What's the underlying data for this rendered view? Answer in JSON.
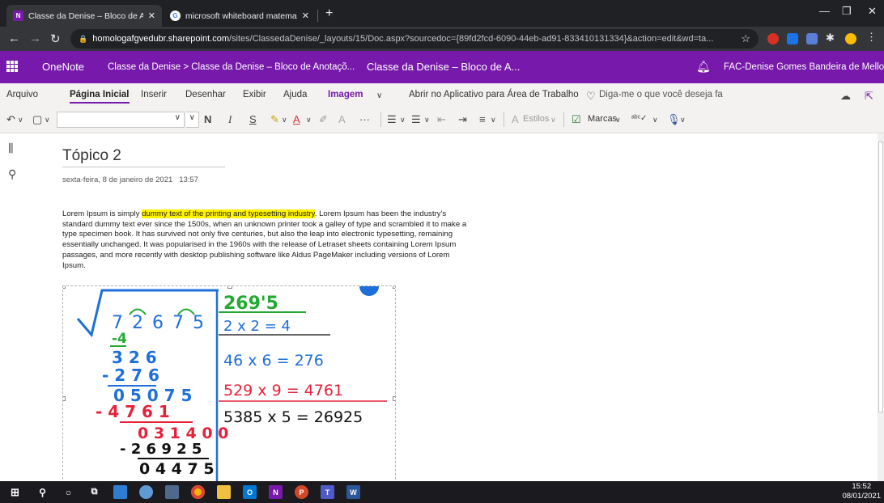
{
  "browser": {
    "tabs": [
      {
        "title": "Classe da Denise – Bloco de Anot",
        "favicon": "N"
      },
      {
        "title": "microsoft whiteboard matematic",
        "favicon": "G"
      }
    ],
    "url_host": "homologafgvedubr.sharepoint.com",
    "url_path": "/sites/ClassedaDenise/_layouts/15/Doc.aspx?sourcedoc={89fd2fcd-6090-44eb-ad91-833410131334}&action=edit&wd=ta..."
  },
  "onenote": {
    "app": "OneNote",
    "breadcrumb": "Classe da Denise  >  Classe da Denise – Bloco de Anotaçõ...",
    "notebook_title": "Classe da Denise – Bloco de A...",
    "user": "FAC-Denise Gomes Bandeira de Mello",
    "accent": "#7719aa"
  },
  "ribbon": {
    "tabs": [
      "Arquivo",
      "Página Inicial",
      "Inserir",
      "Desenhar",
      "Exibir",
      "Ajuda",
      "Imagem"
    ],
    "open_app": "Abrir no Aplicativo para Área de Trabalho",
    "tell_me": "Diga-me o que você deseja fa",
    "bold": "N",
    "italic": "I",
    "underline": "S",
    "styles": "Estilos",
    "tags": "Marcas"
  },
  "page": {
    "title": "Tópico 2",
    "date": "sexta-feira, 8 de janeiro de 2021",
    "time": "13:57",
    "body_1": "Lorem Ipsum is simply ",
    "body_highlight": "dummy text of the printing and typesetting industry",
    "body_2": ". Lorem Ipsum has been the industry's standard dummy text ever since the 1500s, when an unknown printer took a galley of type and scrambled it to make a type specimen book. It has survived not only five centuries, but also the leap into electronic typesetting, remaining essentially unchanged. It was popularised in the 1960s with the release of Letraset sheets containing Lorem Ipsum passages, and more recently with desktop publishing software like Aldus PageMaker including versions of Lorem Ipsum.",
    "drawing": {
      "radicand": "7 2 6 7 5",
      "root": "269'5",
      "step1": "2 x 2 = 4",
      "step2": "46 x 6 = 276",
      "step3": "529 x 9 = 4761",
      "step4": "5385 x 5 = 26925",
      "left1": "-4",
      "left2": "3 2 6",
      "left3": "- 2 7 6",
      "left4": "0 5 0 7 5",
      "left5": "- 4 7 6 1",
      "left6": "0 3 1 4 0 0",
      "left7": "- 2 6 9 2 5",
      "left8": "0 4 4 7 5"
    }
  },
  "taskbar": {
    "time": "15:52",
    "date": "08/01/2021"
  }
}
